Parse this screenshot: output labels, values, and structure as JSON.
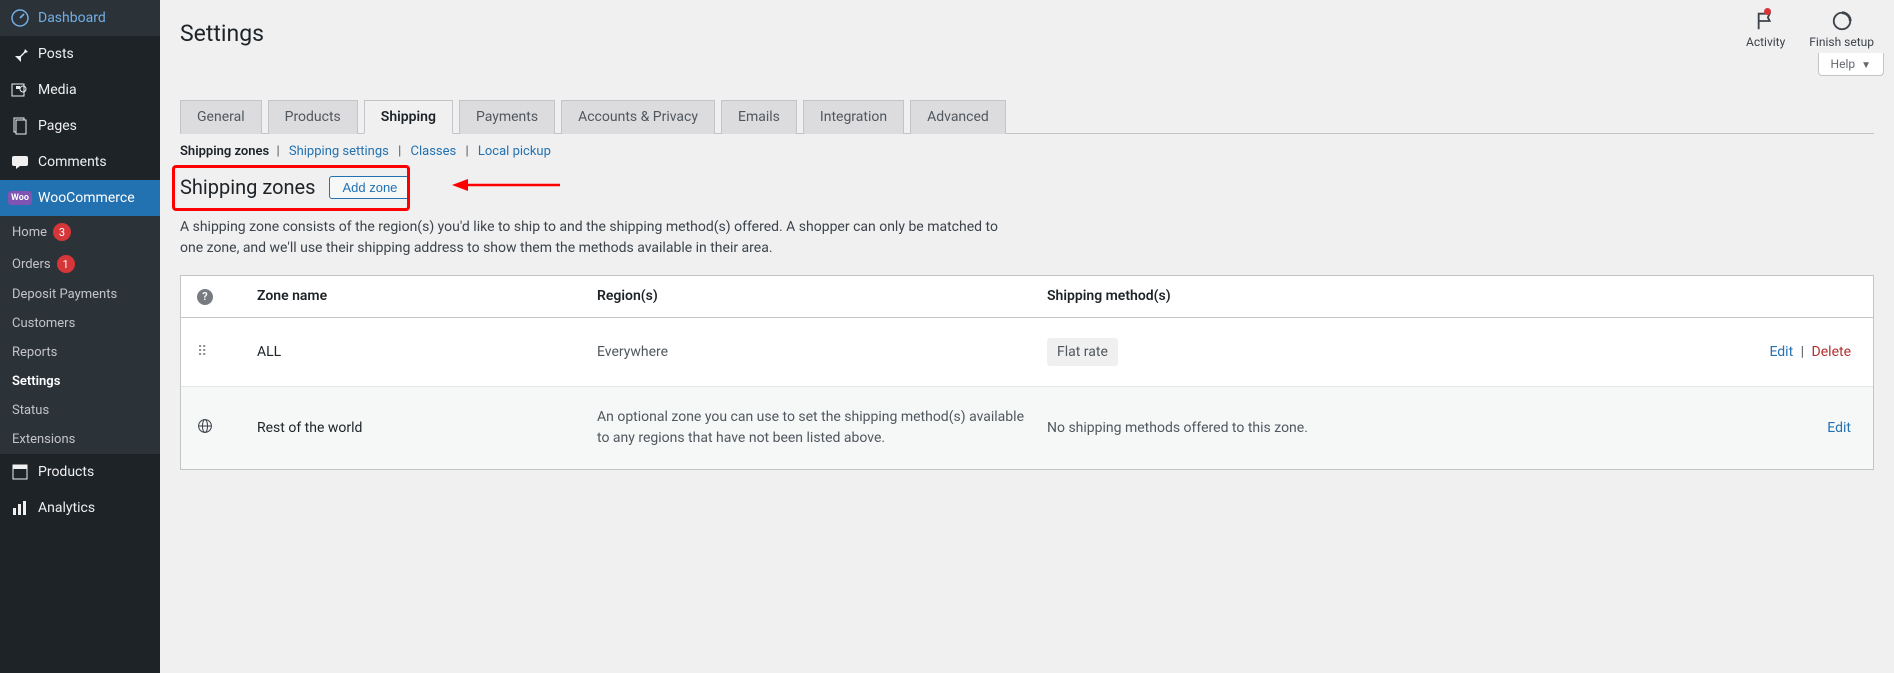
{
  "sidebar": {
    "items": [
      {
        "label": "Dashboard"
      },
      {
        "label": "Posts"
      },
      {
        "label": "Media"
      },
      {
        "label": "Pages"
      },
      {
        "label": "Comments"
      },
      {
        "label": "WooCommerce",
        "badge_text": "Woo"
      },
      {
        "label": "Products"
      },
      {
        "label": "Analytics"
      }
    ],
    "woo_sub": [
      {
        "label": "Home",
        "badge": "3"
      },
      {
        "label": "Orders",
        "badge": "1"
      },
      {
        "label": "Deposit Payments"
      },
      {
        "label": "Customers"
      },
      {
        "label": "Reports"
      },
      {
        "label": "Settings",
        "current": true
      },
      {
        "label": "Status"
      },
      {
        "label": "Extensions"
      }
    ]
  },
  "header": {
    "page_title": "Settings",
    "activity": "Activity",
    "finish_setup": "Finish setup",
    "help": "Help"
  },
  "tabs": [
    {
      "label": "General"
    },
    {
      "label": "Products"
    },
    {
      "label": "Shipping",
      "active": true
    },
    {
      "label": "Payments"
    },
    {
      "label": "Accounts & Privacy"
    },
    {
      "label": "Emails"
    },
    {
      "label": "Integration"
    },
    {
      "label": "Advanced"
    }
  ],
  "subnav": {
    "current": "Shipping zones",
    "links": [
      "Shipping settings",
      "Classes",
      "Local pickup"
    ]
  },
  "zones": {
    "heading": "Shipping zones",
    "add_button": "Add zone",
    "description": "A shipping zone consists of the region(s) you'd like to ship to and the shipping method(s) offered. A shopper can only be matched to one zone, and we'll use their shipping address to show them the methods available in their area.",
    "columns": {
      "name": "Zone name",
      "region": "Region(s)",
      "methods": "Shipping method(s)"
    },
    "rows": [
      {
        "name": "ALL",
        "region": "Everywhere",
        "method": "Flat rate",
        "edit": "Edit",
        "delete": "Delete",
        "draggable": true
      },
      {
        "name": "Rest of the world",
        "region": "An optional zone you can use to set the shipping method(s) available to any regions that have not been listed above.",
        "method": "No shipping methods offered to this zone.",
        "edit": "Edit",
        "globe": true
      }
    ]
  },
  "colors": {
    "accent": "#2271b1",
    "danger": "#d63638",
    "highlight": "#ff0000"
  }
}
